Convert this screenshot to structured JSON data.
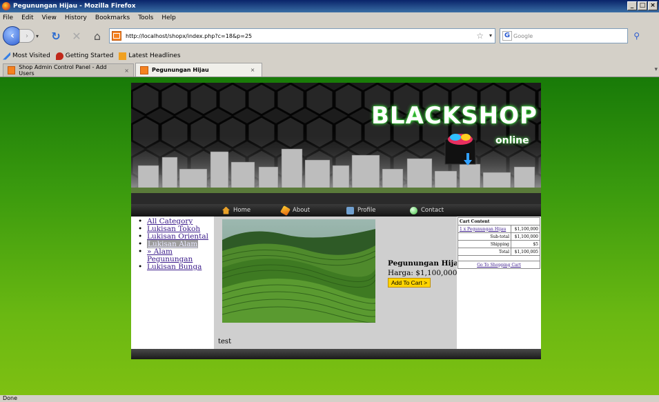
{
  "window": {
    "title": "Pegunungan Hijau - Mozilla Firefox"
  },
  "menu": [
    "File",
    "Edit",
    "View",
    "History",
    "Bookmarks",
    "Tools",
    "Help"
  ],
  "nav": {
    "url": "http://localhost/shopx/index.php?c=18&p=25",
    "search_placeholder": "Google"
  },
  "bookmarks": [
    "Most Visited",
    "Getting Started",
    "Latest Headlines"
  ],
  "tabs": [
    {
      "label": "Shop Admin Control Panel - Add Users",
      "active": false
    },
    {
      "label": "Pegunungan Hijau",
      "active": true
    }
  ],
  "site": {
    "logo": "BLACKSHOP",
    "logo_sub": "online",
    "menu": [
      "Home",
      "About",
      "Profile",
      "Contact"
    ],
    "categories": [
      {
        "label": "All Category"
      },
      {
        "label": "Lukisan Tokoh"
      },
      {
        "label": "Lukisan Oriental"
      },
      {
        "label": "Lukisan Alam"
      },
      {
        "label": "» Alam Pegunungan"
      },
      {
        "label": "Lukisan Bunga"
      }
    ],
    "product": {
      "name": "Pegunungan Hijau",
      "price_label": "Harga: $1,100,000",
      "add_button": "Add To Cart >",
      "description": "test"
    },
    "cart": {
      "title": "Cart Content",
      "item_label": "1 x Pegunungan Hijau",
      "item_price": "$1,100,000",
      "subtotal_label": "Sub-total",
      "subtotal_value": "$1,100,000",
      "shipping_label": "Shipping",
      "shipping_value": "$5",
      "total_label": "Total",
      "total_value": "$1,100,005",
      "checkout_link": "Go To Shopping Cart"
    }
  },
  "status": "Done"
}
